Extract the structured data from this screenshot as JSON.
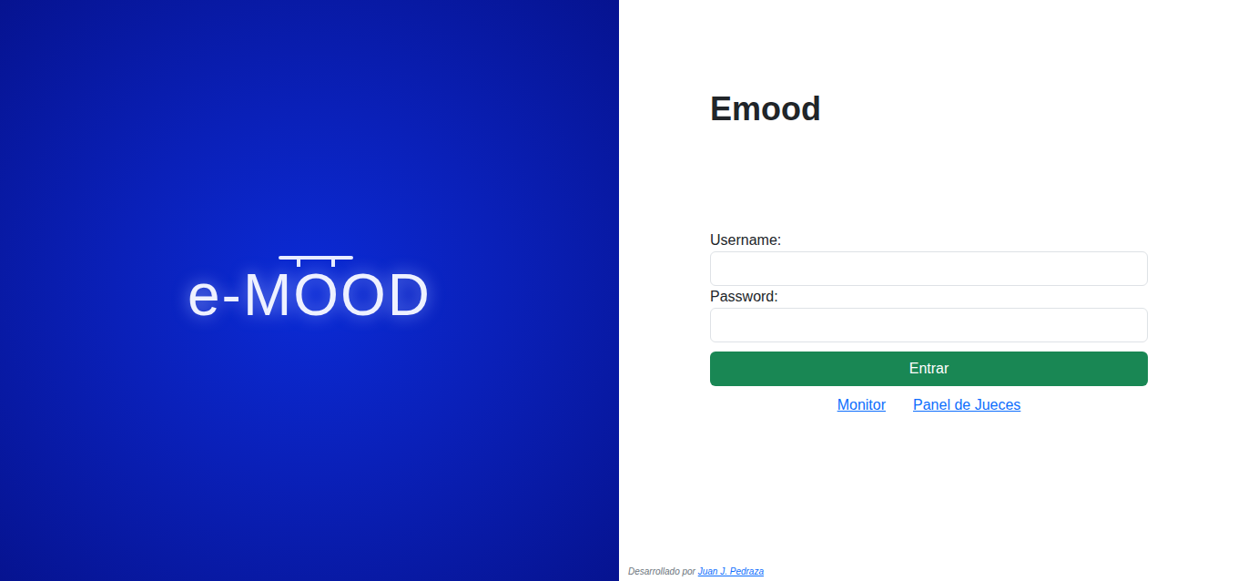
{
  "brand": {
    "logo": "e-MOOD"
  },
  "heading": "Emood",
  "form": {
    "fields": [
      {
        "label": "Username:",
        "value": "",
        "kind": "text"
      },
      {
        "label": "Password:",
        "value": "",
        "kind": "password"
      }
    ],
    "submit": "Entrar"
  },
  "links": [
    "Monitor",
    "Panel de Jueces"
  ],
  "footer": {
    "text": "Desarrollado por",
    "author": "Juan J. Pedraza"
  }
}
